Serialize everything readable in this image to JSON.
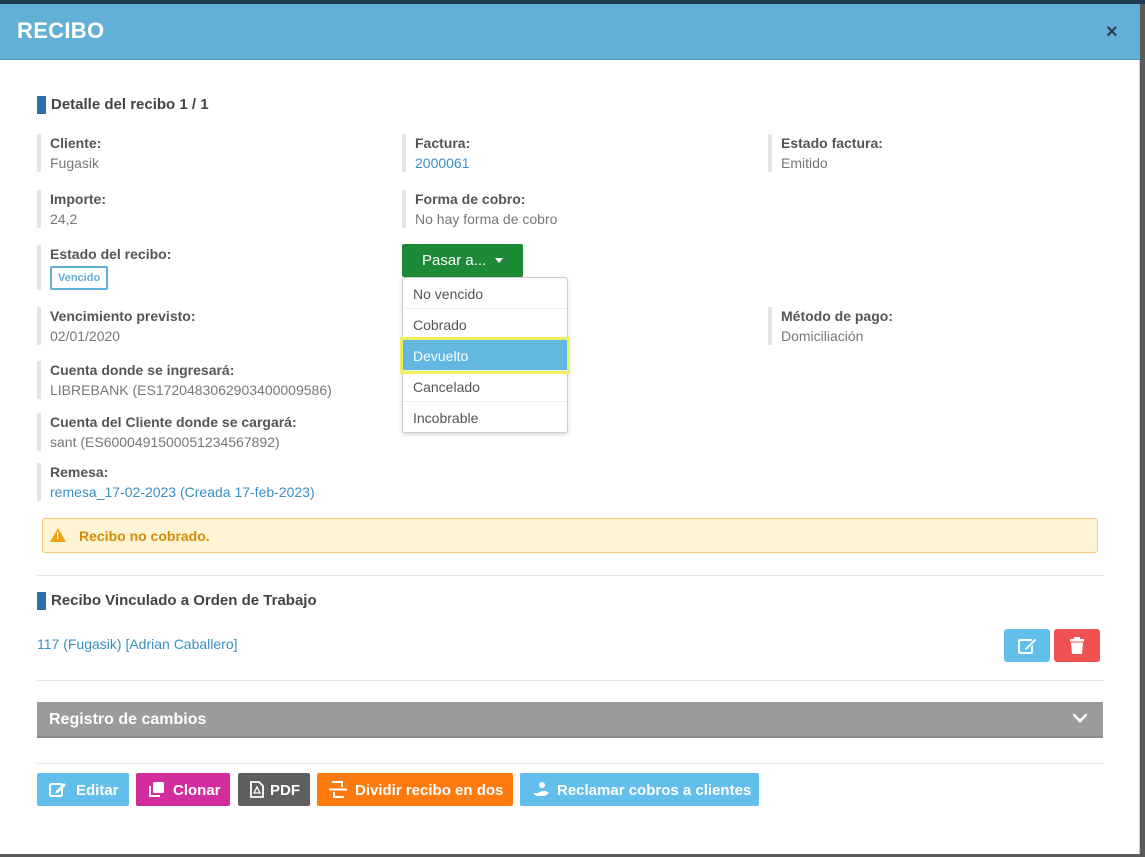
{
  "modal": {
    "title": "RECIBO",
    "close": "×"
  },
  "detail": {
    "section_title": "Detalle del recibo 1 / 1",
    "cliente": {
      "label": "Cliente:",
      "value": "Fugasik"
    },
    "factura": {
      "label": "Factura:",
      "value": "2000061"
    },
    "estado_factura": {
      "label": "Estado factura:",
      "value": "Emitido"
    },
    "importe": {
      "label": "Importe:",
      "value": "24,2"
    },
    "forma_cobro": {
      "label": "Forma de cobro:",
      "value": "No hay forma de cobro"
    },
    "estado_recibo": {
      "label": "Estado del recibo:",
      "badge": "Vencido"
    },
    "vencimiento": {
      "label": "Vencimiento previsto:",
      "value": "02/01/2020"
    },
    "metodo_pago": {
      "label": "Método de pago:",
      "value": "Domiciliación"
    },
    "cuenta_ingreso": {
      "label": "Cuenta donde se ingresará:",
      "value": "LIBREBANK (ES1720483062903400009586)"
    },
    "cuenta_cliente": {
      "label": "Cuenta del Cliente donde se cargará:",
      "value": "sant (ES6000491500051234567892)"
    },
    "remesa": {
      "label": "Remesa:",
      "value": "remesa_17-02-2023 (Creada 17-feb-2023)"
    }
  },
  "pasar_menu": {
    "button_label": "Pasar a...",
    "items": [
      "No vencido",
      "Cobrado",
      "Devuelto",
      "Cancelado",
      "Incobrable"
    ],
    "highlighted": "Devuelto"
  },
  "alert": {
    "text": "Recibo no cobrado."
  },
  "vinculado": {
    "section_title": "Recibo Vinculado a Orden de Trabajo",
    "link": "117 (Fugasik) [Adrian Caballero]"
  },
  "registro": {
    "title": "Registro de cambios"
  },
  "actions": {
    "editar": "Editar",
    "clonar": "Clonar",
    "pdf": "PDF",
    "dividir": "Dividir recibo en dos",
    "reclamar": "Reclamar cobros a clientes"
  },
  "colors": {
    "header": "#62b0d5",
    "green": "#1c8a36",
    "editar": "#62bfeb",
    "clonar": "#d32c9e",
    "pdf": "#5f5f5f",
    "dividir": "#fc7a0e",
    "reclamar": "#62bfeb",
    "delete": "#f05252"
  }
}
